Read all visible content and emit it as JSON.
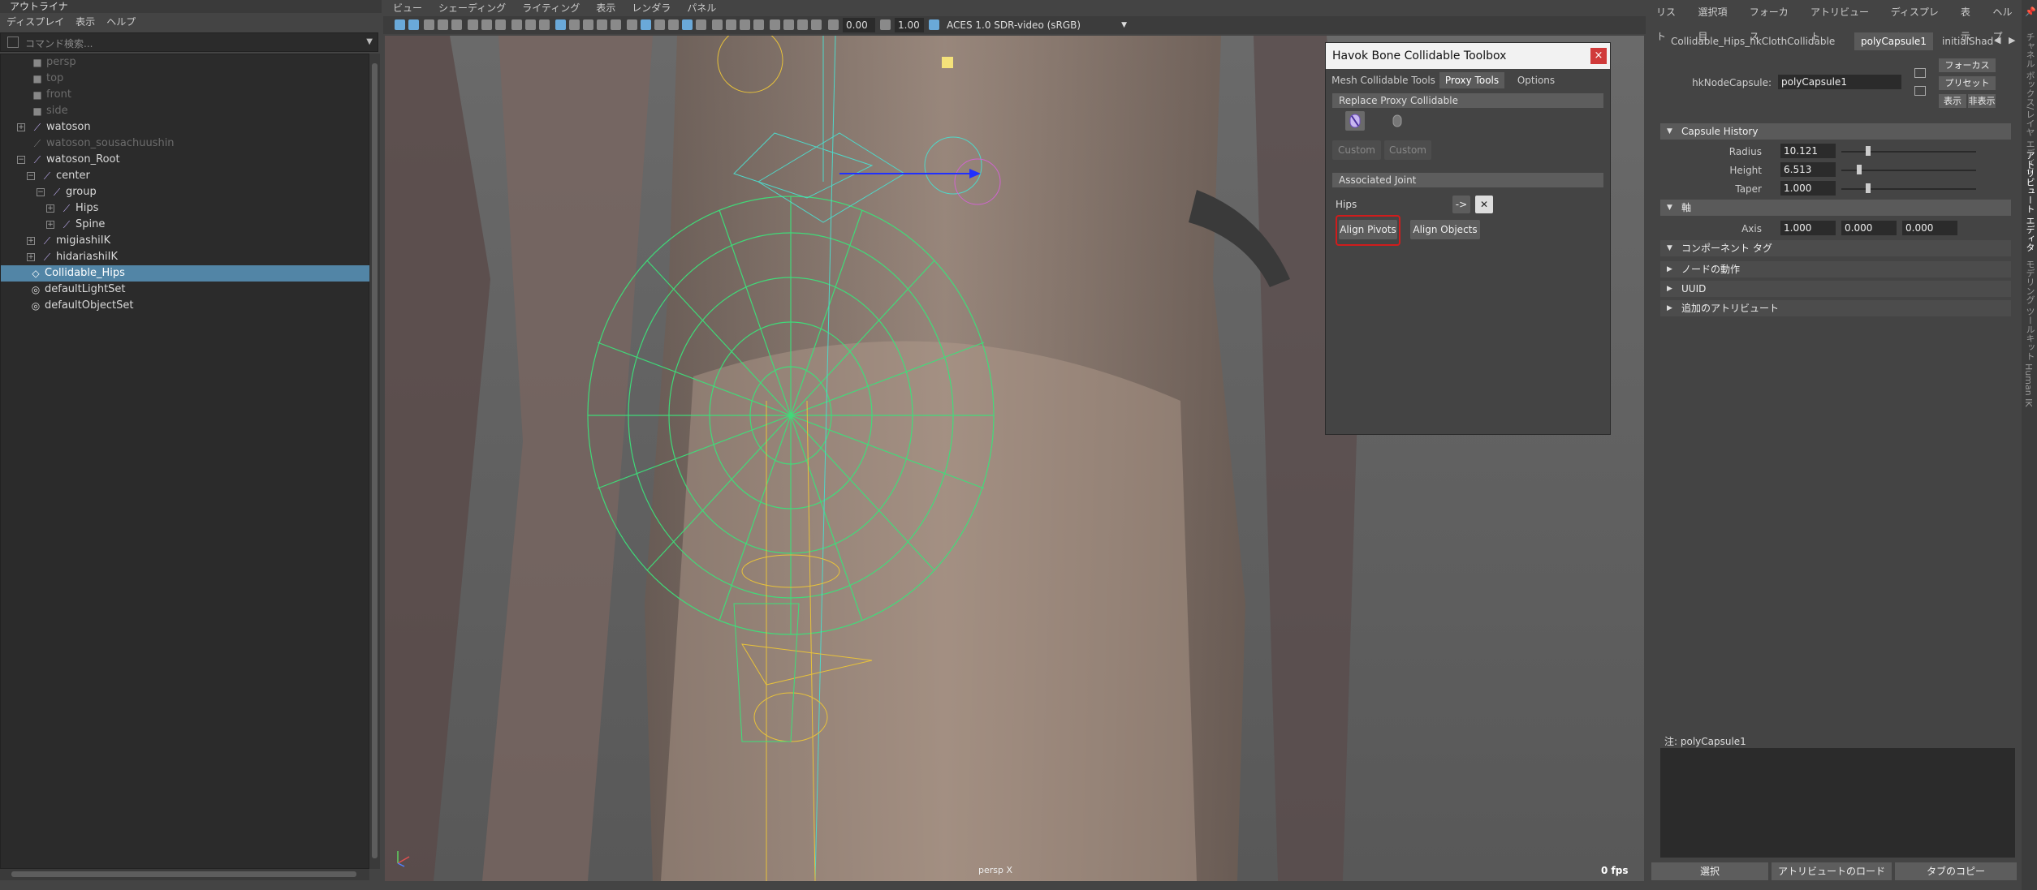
{
  "outliner": {
    "title": "アウトライナ",
    "menu": [
      "ディスプレイ",
      "表示",
      "ヘルプ"
    ],
    "search_placeholder": "コマンド検索...",
    "items": [
      {
        "label": "persp",
        "dim": true
      },
      {
        "label": "top",
        "dim": true
      },
      {
        "label": "front",
        "dim": true
      },
      {
        "label": "side",
        "dim": true
      },
      {
        "label": "watoson",
        "dim": false
      },
      {
        "label": "watoson_sousachuushin",
        "dim": true
      },
      {
        "label": "watoson_Root",
        "dim": false
      },
      {
        "label": "center",
        "dim": false
      },
      {
        "label": "group",
        "dim": false
      },
      {
        "label": "Hips",
        "dim": false
      },
      {
        "label": "Spine",
        "dim": false
      },
      {
        "label": "migiashiIK",
        "dim": false
      },
      {
        "label": "hidariashiIK",
        "dim": false
      },
      {
        "label": "Collidable_Hips",
        "dim": false,
        "selected": true
      },
      {
        "label": "defaultLightSet",
        "dim": false
      },
      {
        "label": "defaultObjectSet",
        "dim": false
      }
    ]
  },
  "viewport": {
    "menu": [
      "ビュー",
      "シェーディング",
      "ライティング",
      "表示",
      "レンダラ",
      "パネル"
    ],
    "exposure": "0.00",
    "gamma": "1.00",
    "color_space": "ACES 1.0 SDR-video (sRGB)",
    "camera_label": "persp X",
    "fps": "0 fps"
  },
  "havok": {
    "title": "Havok Bone Collidable Toolbox",
    "close": "×",
    "tabs": [
      "Mesh Collidable Tools",
      "Proxy Tools",
      "Options"
    ],
    "active_tab": "Proxy Tools",
    "section_replace": "Replace Proxy Collidable",
    "custom_1": "Custom",
    "custom_2": "Custom",
    "section_joint": "Associated Joint",
    "joint_value": "Hips",
    "arrow_button": "->",
    "clear_button": "✕",
    "align_pivots": "Align Pivots",
    "align_objects": "Align Objects"
  },
  "attribute_editor": {
    "menu": [
      "リスト",
      "選択項目",
      "フォーカス",
      "アトリビュート",
      "ディスプレイ",
      "表示",
      "ヘルプ"
    ],
    "tabs": [
      "Collidable_Hips_hkClothCollidable",
      "polyCapsule1",
      "initialShad"
    ],
    "node_label": "hkNodeCapsule:",
    "node_value": "polyCapsule1",
    "btn_focus": "フォーカス",
    "btn_preset": "プリセット",
    "btn_show": "表示",
    "btn_hide": "非表示",
    "section_history": "Capsule History",
    "radius_label": "Radius",
    "radius_value": "10.121",
    "radius_level": 0.2,
    "height_label": "Height",
    "height_value": "6.513",
    "height_level": 0.13,
    "taper_label": "Taper",
    "taper_value": "1.000",
    "taper_level": 0.2,
    "section_axis": "軸",
    "axis_label": "Axis",
    "axis_values": [
      "1.000",
      "0.000",
      "0.000"
    ],
    "section_component_tag": "コンポーネント タグ",
    "section_node_behavior": "ノードの動作",
    "section_uuid": "UUID",
    "section_extra": "追加のアトリビュート",
    "notes_label": "注:  polyCapsule1",
    "footer": [
      "選択",
      "アトリビュートのロード",
      "タブのコピー"
    ],
    "side_tabs": [
      "チャネル ボックス/レイヤ エディタ",
      "アトリビュート エディタ",
      "モデリング ツールキット",
      "Human IK"
    ]
  },
  "colors": {
    "selection": "#5285a6",
    "wire_green": "#3de07a",
    "wire_yellow": "#e8c23a",
    "highlight_red": "#d01c1c"
  }
}
